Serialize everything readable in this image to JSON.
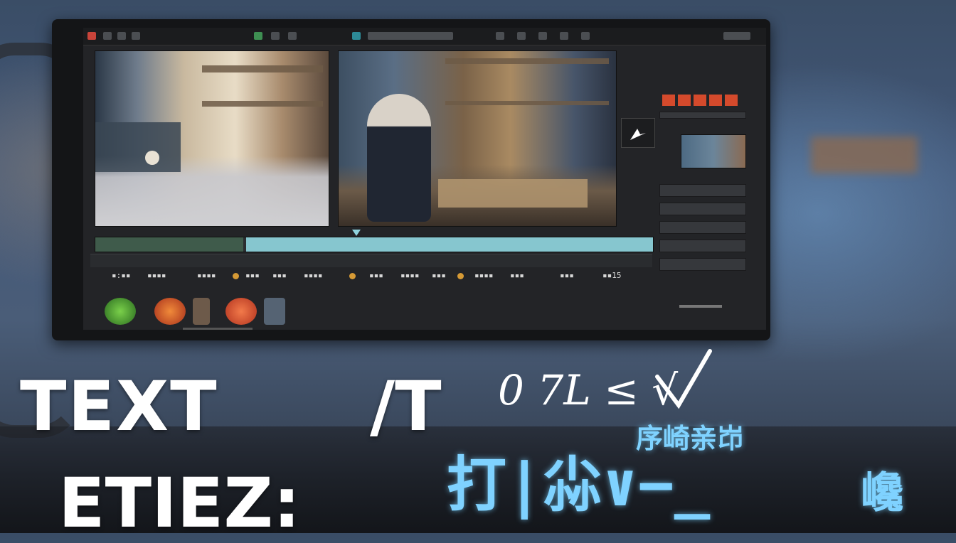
{
  "overlay": {
    "line1_left": "TEXT",
    "line1_right": "/T",
    "line2": "ETIEZ:",
    "script": "0 7L ≤ √",
    "glitch_top": "序崎亲岇",
    "glitch_mid": "打|尛∨−̲",
    "glitch_right": "巉"
  },
  "editor": {
    "timecodes": [
      "▪:▪▪",
      "▪▪▪▪",
      "▪▪▪▪",
      "▪▪▪",
      "▪▪▪",
      "▪▪▪▪",
      "▪▪▪",
      "▪▪▪▪",
      "▪▪▪",
      "▪▪▪▪",
      "▪▪▪",
      "▪▪▪",
      "▪▪15"
    ],
    "accent_clip": "#86c6cf",
    "accent_record": "#c8443a"
  },
  "icons": [
    "menu-icon",
    "play-marker-icon",
    "pointer-cursor-icon",
    "effect-green-icon",
    "effect-red-icon",
    "effect-orange-icon",
    "bird-effect-icon"
  ]
}
